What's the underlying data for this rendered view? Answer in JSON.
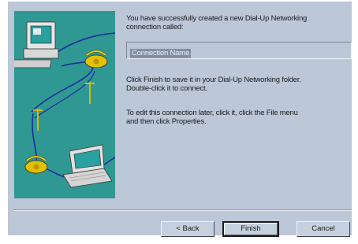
{
  "wizard": {
    "intro_text": "You have successfully created a new Dial-Up Networking\nconnection called:",
    "connection_name": "Connection Name",
    "finish_note": "Click Finish to save it in your Dial-Up Networking folder.\nDouble-click it to connect.",
    "edit_note": "To edit this connection later, click it, click the File menu\nand then click Properties."
  },
  "buttons": {
    "back_label": "< Back",
    "finish_label": "Finish",
    "cancel_label": "Cancel"
  },
  "illustration": {
    "background_color": "#2f9893",
    "icons": [
      "desktop-computer-icon",
      "telephone-icon",
      "utility-pole-icon",
      "laptop-icon"
    ]
  }
}
